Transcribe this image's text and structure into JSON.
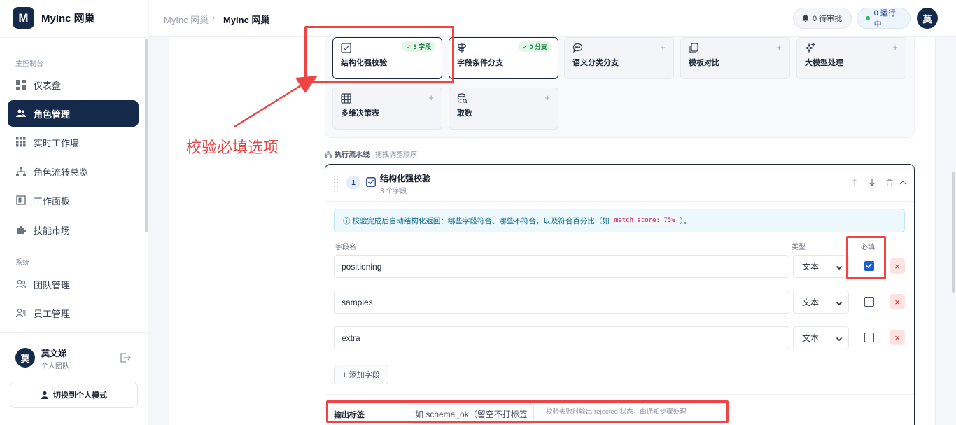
{
  "brand": {
    "logo_letter": "M",
    "name": "MyInc 网巢"
  },
  "sidebar": {
    "section_main": "主控制台",
    "items": [
      {
        "label": "仪表盘",
        "icon": "dashboard-icon"
      },
      {
        "label": "角色管理",
        "icon": "users-icon",
        "active": true
      },
      {
        "label": "实时工作墙",
        "icon": "grid-icon"
      },
      {
        "label": "角色流转总览",
        "icon": "flow-icon"
      },
      {
        "label": "工作面板",
        "icon": "panel-icon"
      },
      {
        "label": "技能市场",
        "icon": "puzzle-icon"
      }
    ],
    "section_system": "系统",
    "system_items": [
      {
        "label": "团队管理",
        "icon": "team-icon"
      },
      {
        "label": "员工管理",
        "icon": "staff-icon"
      }
    ],
    "user": {
      "avatar": "莫",
      "name": "莫文娣",
      "team": "个人团队"
    },
    "switch_button": "切换到个人模式"
  },
  "topbar": {
    "breadcrumb_root": "MyInc 网巢",
    "breadcrumb_sep": "›",
    "breadcrumb_current": "MyInc 网巢",
    "pending": "0 待审批",
    "running": "0 运行中",
    "avatar": "莫"
  },
  "node_types": [
    {
      "label": "结构化强校验",
      "icon": "checkbox-icon",
      "badge": "✓ 3 字段",
      "selected": true
    },
    {
      "label": "字段条件分支",
      "icon": "signpost-icon",
      "badge": "✓ 0 分支",
      "selected": true
    },
    {
      "label": "语义分类分支",
      "icon": "chat-icon",
      "plus": "+"
    },
    {
      "label": "模板对比",
      "icon": "copy-icon",
      "plus": "+"
    },
    {
      "label": "大模型处理",
      "icon": "sparkle-icon",
      "plus": "+"
    },
    {
      "label": "多维决策表",
      "icon": "table-icon",
      "plus": "+"
    },
    {
      "label": "取数",
      "icon": "database-icon",
      "plus": "+"
    }
  ],
  "pipeline": {
    "title": "执行流水线",
    "hint": "拖拽调整顺序",
    "step": {
      "number": "1",
      "name": "结构化强校验",
      "count": "3 个字段",
      "info_prefix": "ⓘ 校验完成后自动结构化返回：哪些字段符合、哪些不符合，以及符合百分比（如",
      "info_code": "match_score: 75%",
      "info_suffix": "）。",
      "col_field": "字段名",
      "col_type": "类型",
      "col_required": "必填",
      "fields": [
        {
          "name": "positioning",
          "type": "文本",
          "required": true
        },
        {
          "name": "samples",
          "type": "文本",
          "required": false
        },
        {
          "name": "extra",
          "type": "文本",
          "required": false
        }
      ],
      "add_field": "+ 添加字段",
      "output_label": "输出标签",
      "output_placeholder": "如 schema_ok（留空不打标签",
      "output_hint": "校验失败时输出 rejected 状态，由通知步骤处理"
    }
  },
  "annotation": {
    "text": "校验必填选项",
    "color": "#e54848"
  },
  "colors": {
    "brand": "#15294b",
    "accent": "#1d5fd1",
    "danger": "#dc2626",
    "success": "#15803d"
  }
}
